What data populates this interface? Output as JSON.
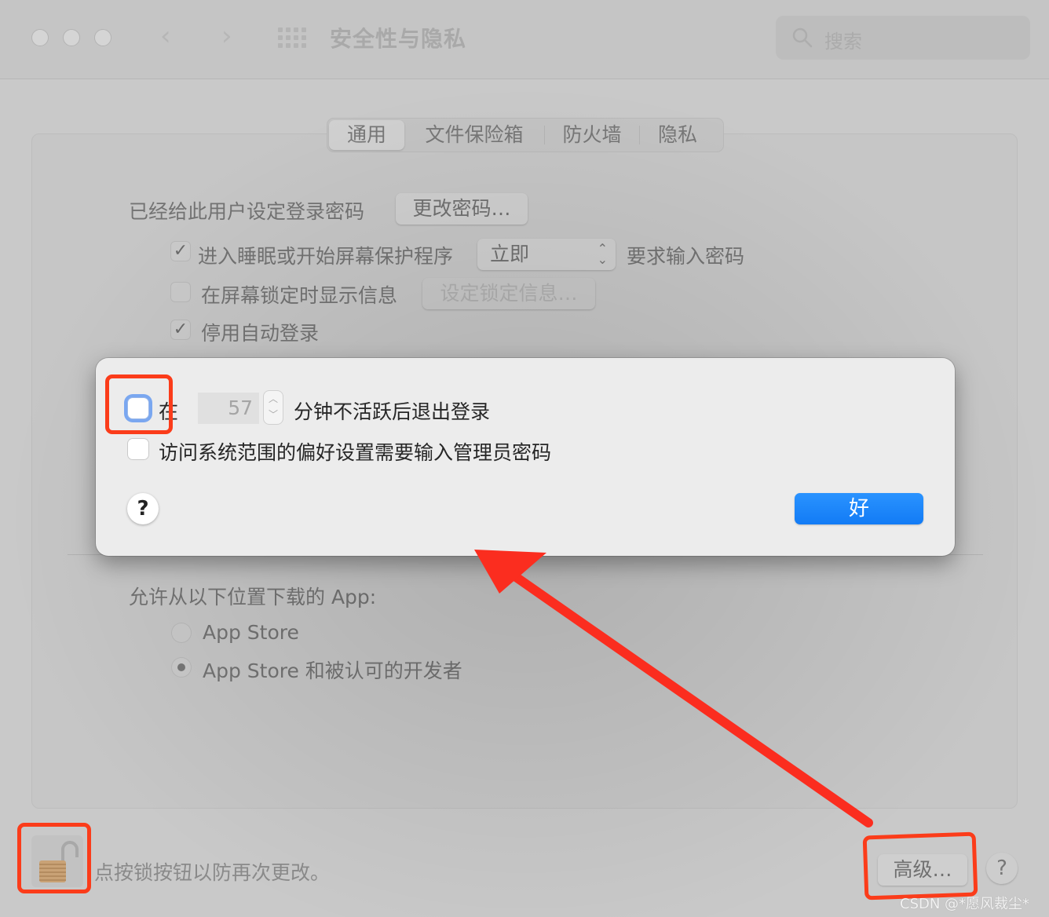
{
  "window": {
    "title": "安全性与隐私",
    "search_placeholder": "搜索",
    "traffic_lights": [
      "close",
      "minimize",
      "zoom"
    ],
    "nav": {
      "back_icon": "‹",
      "forward_icon": "›"
    }
  },
  "tabs": [
    {
      "label": "通用",
      "active": true
    },
    {
      "label": "文件保险箱",
      "active": false
    },
    {
      "label": "防火墙",
      "active": false
    },
    {
      "label": "隐私",
      "active": false
    }
  ],
  "general": {
    "password_set_label": "已经给此用户设定登录密码",
    "change_password_button": "更改密码…",
    "require_password": {
      "checked": true,
      "label": "进入睡眠或开始屏幕保护程序",
      "select_value": "立即",
      "suffix": "要求输入密码"
    },
    "show_message": {
      "checked": false,
      "label": "在屏幕锁定时显示信息",
      "button": "设定锁定信息…"
    },
    "disable_auto_login": {
      "checked": true,
      "label": "停用自动登录"
    },
    "check_mark": "✓"
  },
  "downloads": {
    "label": "允许从以下位置下载的 App:",
    "options": [
      {
        "label": "App Store",
        "selected": false
      },
      {
        "label": "App Store 和被认可的开发者",
        "selected": true
      }
    ]
  },
  "advanced_dialog": {
    "logout_checkbox": {
      "checked": false,
      "prefix": "在",
      "minutes": "57",
      "suffix": "分钟不活跃后退出登录"
    },
    "admin_password_checkbox": {
      "checked": false,
      "label": "访问系统范围的偏好设置需要输入管理员密码"
    },
    "help_label": "?",
    "ok_label": "好"
  },
  "footer": {
    "lock_text": "点按锁按钮以防再次更改。",
    "advanced_button": "高级…",
    "help_label": "?"
  },
  "watermark": "CSDN @*愿风裁尘*",
  "colors": {
    "accent_blue": "#1a84f8",
    "annotation_red": "#fb3c1a"
  }
}
